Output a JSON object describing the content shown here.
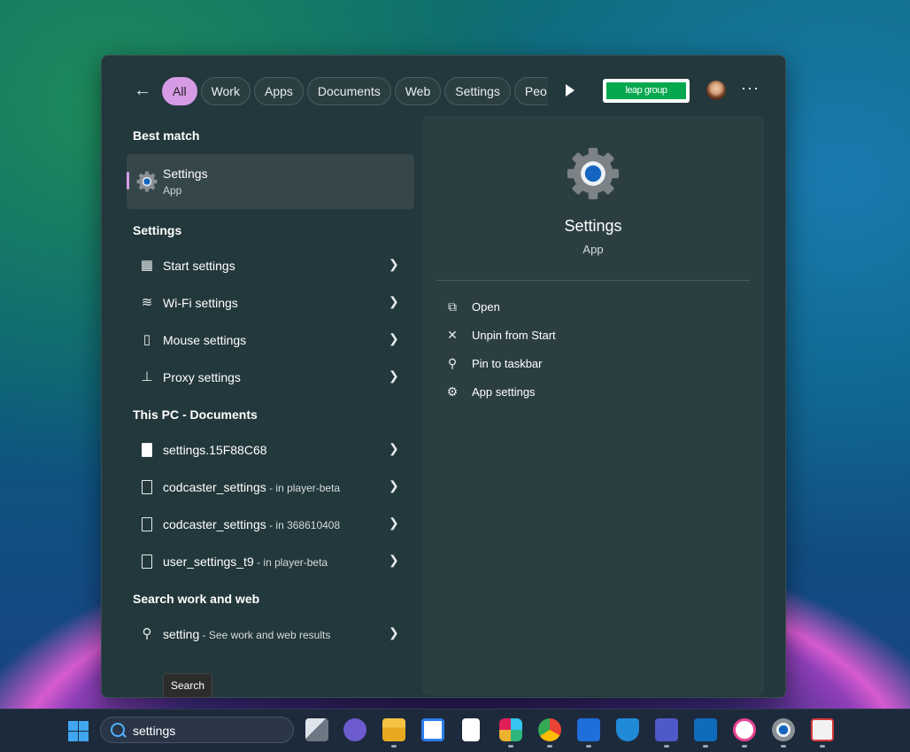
{
  "filters": {
    "back_label": "←",
    "chips": [
      "All",
      "Work",
      "Apps",
      "Documents",
      "Web",
      "Settings",
      "Peo"
    ],
    "active": "All",
    "org_logo_text": "leap group",
    "more_label": "···"
  },
  "best_match": {
    "heading": "Best match",
    "title": "Settings",
    "subtitle": "App"
  },
  "settings_section": {
    "heading": "Settings",
    "items": [
      {
        "label": "Start settings",
        "icon": "start-settings-icon"
      },
      {
        "label": "Wi-Fi settings",
        "icon": "wifi-icon"
      },
      {
        "label": "Mouse settings",
        "icon": "mouse-icon"
      },
      {
        "label": "Proxy settings",
        "icon": "proxy-icon"
      }
    ]
  },
  "documents_section": {
    "heading": "This PC - Documents",
    "items": [
      {
        "name": "settings.15F88C68",
        "location": ""
      },
      {
        "name": "codcaster_settings",
        "location": " - in player-beta"
      },
      {
        "name": "codcaster_settings",
        "location": " - in 368610408"
      },
      {
        "name": "user_settings_t9",
        "location": " - in player-beta"
      }
    ]
  },
  "web_section": {
    "heading": "Search work and web",
    "query": "setting",
    "hint": " - See work and web results"
  },
  "tooltip": "Search",
  "preview": {
    "title": "Settings",
    "subtitle": "App",
    "actions": [
      {
        "label": "Open",
        "icon": "open-external-icon"
      },
      {
        "label": "Unpin from Start",
        "icon": "unpin-icon"
      },
      {
        "label": "Pin to taskbar",
        "icon": "pin-icon"
      },
      {
        "label": "App settings",
        "icon": "gear-icon"
      }
    ]
  },
  "taskbar": {
    "search_value": "settings",
    "apps": [
      "task-view",
      "chat",
      "file-explorer",
      "microsoft-store",
      "notepad",
      "slack",
      "chrome",
      "people",
      "defender",
      "teams",
      "outlook",
      "itunes",
      "settings",
      "snipping-tool"
    ]
  },
  "colors": {
    "accent": "#d79be6",
    "panel": "#23383c",
    "preview_panel": "#2b3f43",
    "windows_blue": "#40a6ef"
  }
}
